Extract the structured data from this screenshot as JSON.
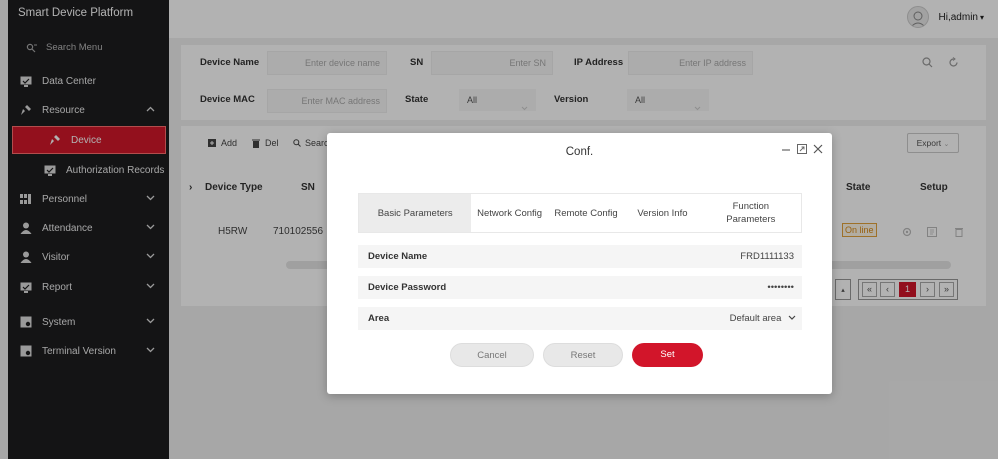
{
  "app": {
    "title": "Smart Device Platform"
  },
  "user": {
    "greeting": "Hi,admin",
    "caret": "▾"
  },
  "sidebar": {
    "search": "Search Menu",
    "items": [
      {
        "label": "Data Center",
        "icon": "monitor-icon"
      },
      {
        "label": "Resource",
        "icon": "satellite-icon",
        "chevron": "^"
      },
      {
        "label": "Device",
        "icon": "satellite-icon"
      },
      {
        "label": "Authorization Records",
        "icon": "monitor-check-icon"
      },
      {
        "label": "Personnel",
        "icon": "people-grid-icon"
      },
      {
        "label": "Attendance",
        "icon": "person-icon"
      },
      {
        "label": "Visitor",
        "icon": "visitor-icon"
      },
      {
        "label": "Report",
        "icon": "report-icon"
      },
      {
        "label": "System",
        "icon": "system-icon"
      },
      {
        "label": "Terminal Version",
        "icon": "terminal-icon"
      }
    ]
  },
  "filter": {
    "device_name_label": "Device Name",
    "device_name_placeholder": "Enter device name",
    "sn_label": "SN",
    "sn_placeholder": "Enter SN",
    "ip_label": "IP Address",
    "ip_placeholder": "Enter IP address",
    "mac_label": "Device MAC",
    "mac_placeholder": "Enter MAC address",
    "state_label": "State",
    "state_value": "All",
    "version_label": "Version",
    "version_value": "All"
  },
  "toolbar": {
    "add": "Add",
    "del": "Del",
    "search": "Search",
    "export": "Export"
  },
  "table": {
    "headers": {
      "device_type": "Device Type",
      "sn": "SN",
      "state": "State",
      "setup": "Setup"
    },
    "row": {
      "device_type": "H5RW",
      "sn": "710102556",
      "state": "On line"
    }
  },
  "pager": {
    "first": "«",
    "prev": "‹",
    "page": "1",
    "next": "›",
    "last": "»"
  },
  "modal": {
    "title": "Conf.",
    "tabs": [
      "Basic Parameters",
      "Network Config",
      "Remote Config",
      "Version Info",
      "Function Parameters"
    ],
    "fields": {
      "device_name_label": "Device Name",
      "device_name_value": "FRD1111133",
      "password_label": "Device Password",
      "password_value": "••••••••",
      "area_label": "Area",
      "area_value": "Default area"
    },
    "buttons": {
      "cancel": "Cancel",
      "reset": "Reset",
      "set": "Set"
    }
  },
  "colors": {
    "accent": "#d2152a",
    "sidebar_bg": "#1d1d1f",
    "online": "#d88a17"
  }
}
